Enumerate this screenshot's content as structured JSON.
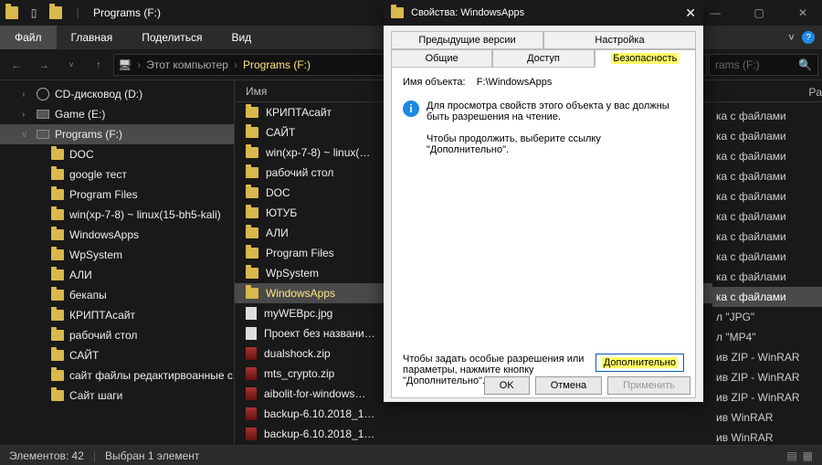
{
  "explorer": {
    "title": "Programs (F:)",
    "tabs": {
      "file": "Файл",
      "home": "Главная",
      "share": "Поделиться",
      "view": "Вид"
    },
    "path": {
      "root": "Этот компьютер",
      "current": "Programs (F:)"
    },
    "search_placeholder": "rams (F:)",
    "col_name": "Имя",
    "type_col": "Pa",
    "tree": [
      {
        "label": "CD-дисковод (D:)",
        "icon": "disc",
        "exp": "›"
      },
      {
        "label": "Game (E:)",
        "icon": "drive",
        "exp": "›"
      },
      {
        "label": "Programs (F:)",
        "icon": "drive",
        "exp": "v",
        "selected": true
      },
      {
        "label": "DOC",
        "icon": "folder",
        "level": 2
      },
      {
        "label": "google тест",
        "icon": "folder",
        "level": 2
      },
      {
        "label": "Program Files",
        "icon": "folder",
        "level": 2
      },
      {
        "label": "win(xp-7-8) ~ linux(15-bh5-kali)",
        "icon": "folder",
        "level": 2
      },
      {
        "label": "WindowsApps",
        "icon": "folder",
        "level": 2
      },
      {
        "label": "WpSystem",
        "icon": "folder",
        "level": 2
      },
      {
        "label": "АЛИ",
        "icon": "folder",
        "level": 2
      },
      {
        "label": "бекапы",
        "icon": "folder",
        "level": 2
      },
      {
        "label": "КРИПТАсайт",
        "icon": "folder",
        "level": 2
      },
      {
        "label": "рабочий стол",
        "icon": "folder",
        "level": 2
      },
      {
        "label": "САЙТ",
        "icon": "folder",
        "level": 2
      },
      {
        "label": "сайт файлы редактирвоанные с",
        "icon": "folder",
        "level": 2
      },
      {
        "label": "Сайт шаги",
        "icon": "folder",
        "level": 2
      }
    ],
    "files": [
      {
        "name": "КРИПТАсайт",
        "icon": "folder"
      },
      {
        "name": "САЙТ",
        "icon": "folder"
      },
      {
        "name": "win(xp-7-8) ~ linux(…",
        "icon": "folder"
      },
      {
        "name": "рабочий стол",
        "icon": "folder"
      },
      {
        "name": "DOC",
        "icon": "folder"
      },
      {
        "name": "ЮТУБ",
        "icon": "folder"
      },
      {
        "name": "АЛИ",
        "icon": "folder"
      },
      {
        "name": "Program Files",
        "icon": "folder"
      },
      {
        "name": "WpSystem",
        "icon": "folder"
      },
      {
        "name": "WindowsApps",
        "icon": "folder",
        "selected": true,
        "hit": true
      },
      {
        "name": "myWEBpc.jpg",
        "icon": "file"
      },
      {
        "name": "Проект без названи…",
        "icon": "file"
      },
      {
        "name": "dualshock.zip",
        "icon": "zip"
      },
      {
        "name": "mts_crypto.zip",
        "icon": "zip"
      },
      {
        "name": "aibolit-for-windows…",
        "icon": "zip"
      },
      {
        "name": "backup-6.10.2018_1…",
        "icon": "zip"
      },
      {
        "name": "backup-6.10.2018_1…",
        "icon": "zip"
      }
    ],
    "types": [
      "ка с файлами",
      "ка с файлами",
      "ка с файлами",
      "ка с файлами",
      "ка с файлами",
      "ка с файлами",
      "ка с файлами",
      "ка с файлами",
      "ка с файлами",
      "ка с файлами",
      "л \"JPG\"",
      "л \"MP4\"",
      "ив ZIP - WinRAR",
      "ив ZIP - WinRAR",
      "ив ZIP - WinRAR",
      "ив WinRAR",
      "ив WinRAR"
    ],
    "status": {
      "count": "Элементов: 42",
      "sel": "Выбран 1 элемент"
    }
  },
  "dialog": {
    "title": "Свойства: WindowsApps",
    "tabs": {
      "prev": "Предыдущие версии",
      "custom": "Настройка",
      "general": "Общие",
      "access": "Доступ",
      "security": "Безопасность"
    },
    "obj_label": "Имя объекта:",
    "obj_value": "F:\\WindowsApps",
    "msg1": "Для просмотра свойств этого объекта у вас должны быть разрешения на чтение.",
    "msg2": "Чтобы продолжить, выберите ссылку \"Дополнительно\".",
    "adv_text": "Чтобы задать особые разрешения или параметры, нажмите кнопку \"Дополнительно\".",
    "adv_btn": "Дополнительно",
    "ok": "OK",
    "cancel": "Отмена",
    "apply": "Применить"
  }
}
